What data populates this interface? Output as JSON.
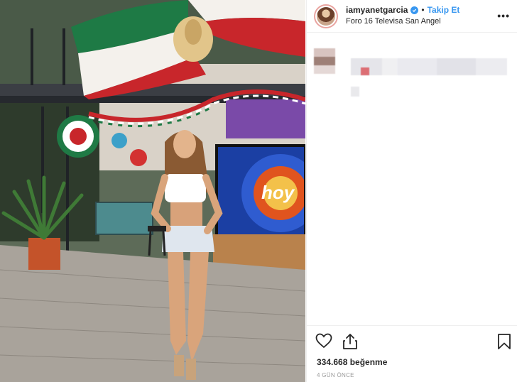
{
  "post": {
    "username": "iamyanetgarcia",
    "follow_label": "Takip Et",
    "separator": "•",
    "location": "Foro 16 Televisa San Angel",
    "more_label": "•••",
    "likes": "334.668 beğenme",
    "time_ago": "4 GÜN ÖNCE"
  },
  "photo": {
    "screen_logo": "hoy"
  },
  "icons": {
    "verified": "verified-badge-icon",
    "like": "heart-icon",
    "share": "share-icon",
    "save": "bookmark-icon",
    "more": "more-options-icon"
  },
  "colors": {
    "link_blue": "#3897f0",
    "avatar_ring": "#e9a4a0",
    "flag_green": "#1e7a45",
    "flag_red": "#c8262b"
  }
}
